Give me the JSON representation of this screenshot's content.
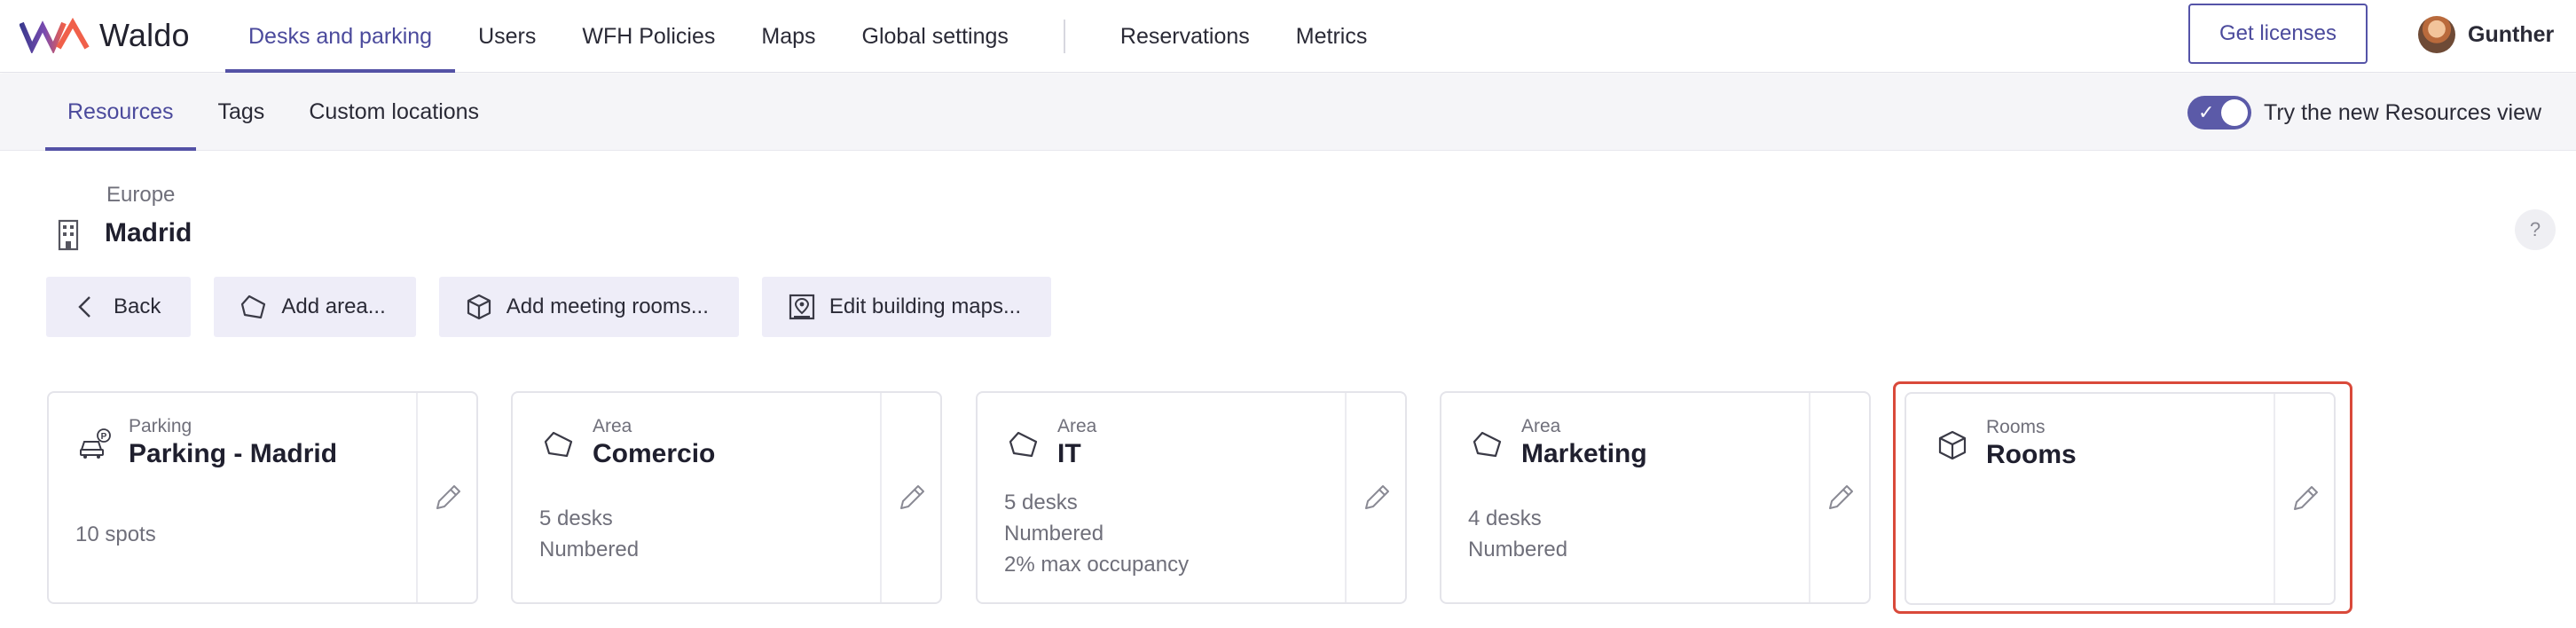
{
  "app": {
    "name": "Waldo"
  },
  "topnav": {
    "items": [
      {
        "label": "Desks and parking",
        "active": true
      },
      {
        "label": "Users",
        "active": false
      },
      {
        "label": "WFH Policies",
        "active": false
      },
      {
        "label": "Maps",
        "active": false
      },
      {
        "label": "Global settings",
        "active": false
      }
    ],
    "items_right": [
      {
        "label": "Reservations",
        "active": false
      },
      {
        "label": "Metrics",
        "active": false
      }
    ],
    "get_licenses_label": "Get licenses",
    "user_name": "Gunther"
  },
  "subnav": {
    "tabs": [
      {
        "label": "Resources",
        "active": true
      },
      {
        "label": "Tags",
        "active": false
      },
      {
        "label": "Custom locations",
        "active": false
      }
    ],
    "toggle_label": "Try the new Resources view",
    "toggle_on": true
  },
  "building": {
    "region": "Europe",
    "name": "Madrid",
    "help_label": "?"
  },
  "actions": {
    "back": "Back",
    "add_area": "Add area...",
    "add_meeting_rooms": "Add meeting rooms...",
    "edit_building_maps": "Edit building maps..."
  },
  "cards": [
    {
      "kind": "Parking",
      "title": "Parking - Madrid",
      "icon": "parking-icon",
      "details": [
        "10 spots"
      ],
      "selected": false
    },
    {
      "kind": "Area",
      "title": "Comercio",
      "icon": "area-icon",
      "details": [
        "5 desks",
        "Numbered"
      ],
      "selected": false
    },
    {
      "kind": "Area",
      "title": "IT",
      "icon": "area-icon",
      "details": [
        "5 desks",
        "Numbered",
        "2% max occupancy"
      ],
      "selected": false
    },
    {
      "kind": "Area",
      "title": "Marketing",
      "icon": "area-icon",
      "details": [
        "4 desks",
        "Numbered"
      ],
      "selected": false
    },
    {
      "kind": "Rooms",
      "title": "Rooms",
      "icon": "room-cube-icon",
      "details": [],
      "selected": true
    }
  ],
  "colors": {
    "accent": "#5452a6",
    "selected_border": "#d9493a",
    "action_bg": "#eeedf8"
  }
}
